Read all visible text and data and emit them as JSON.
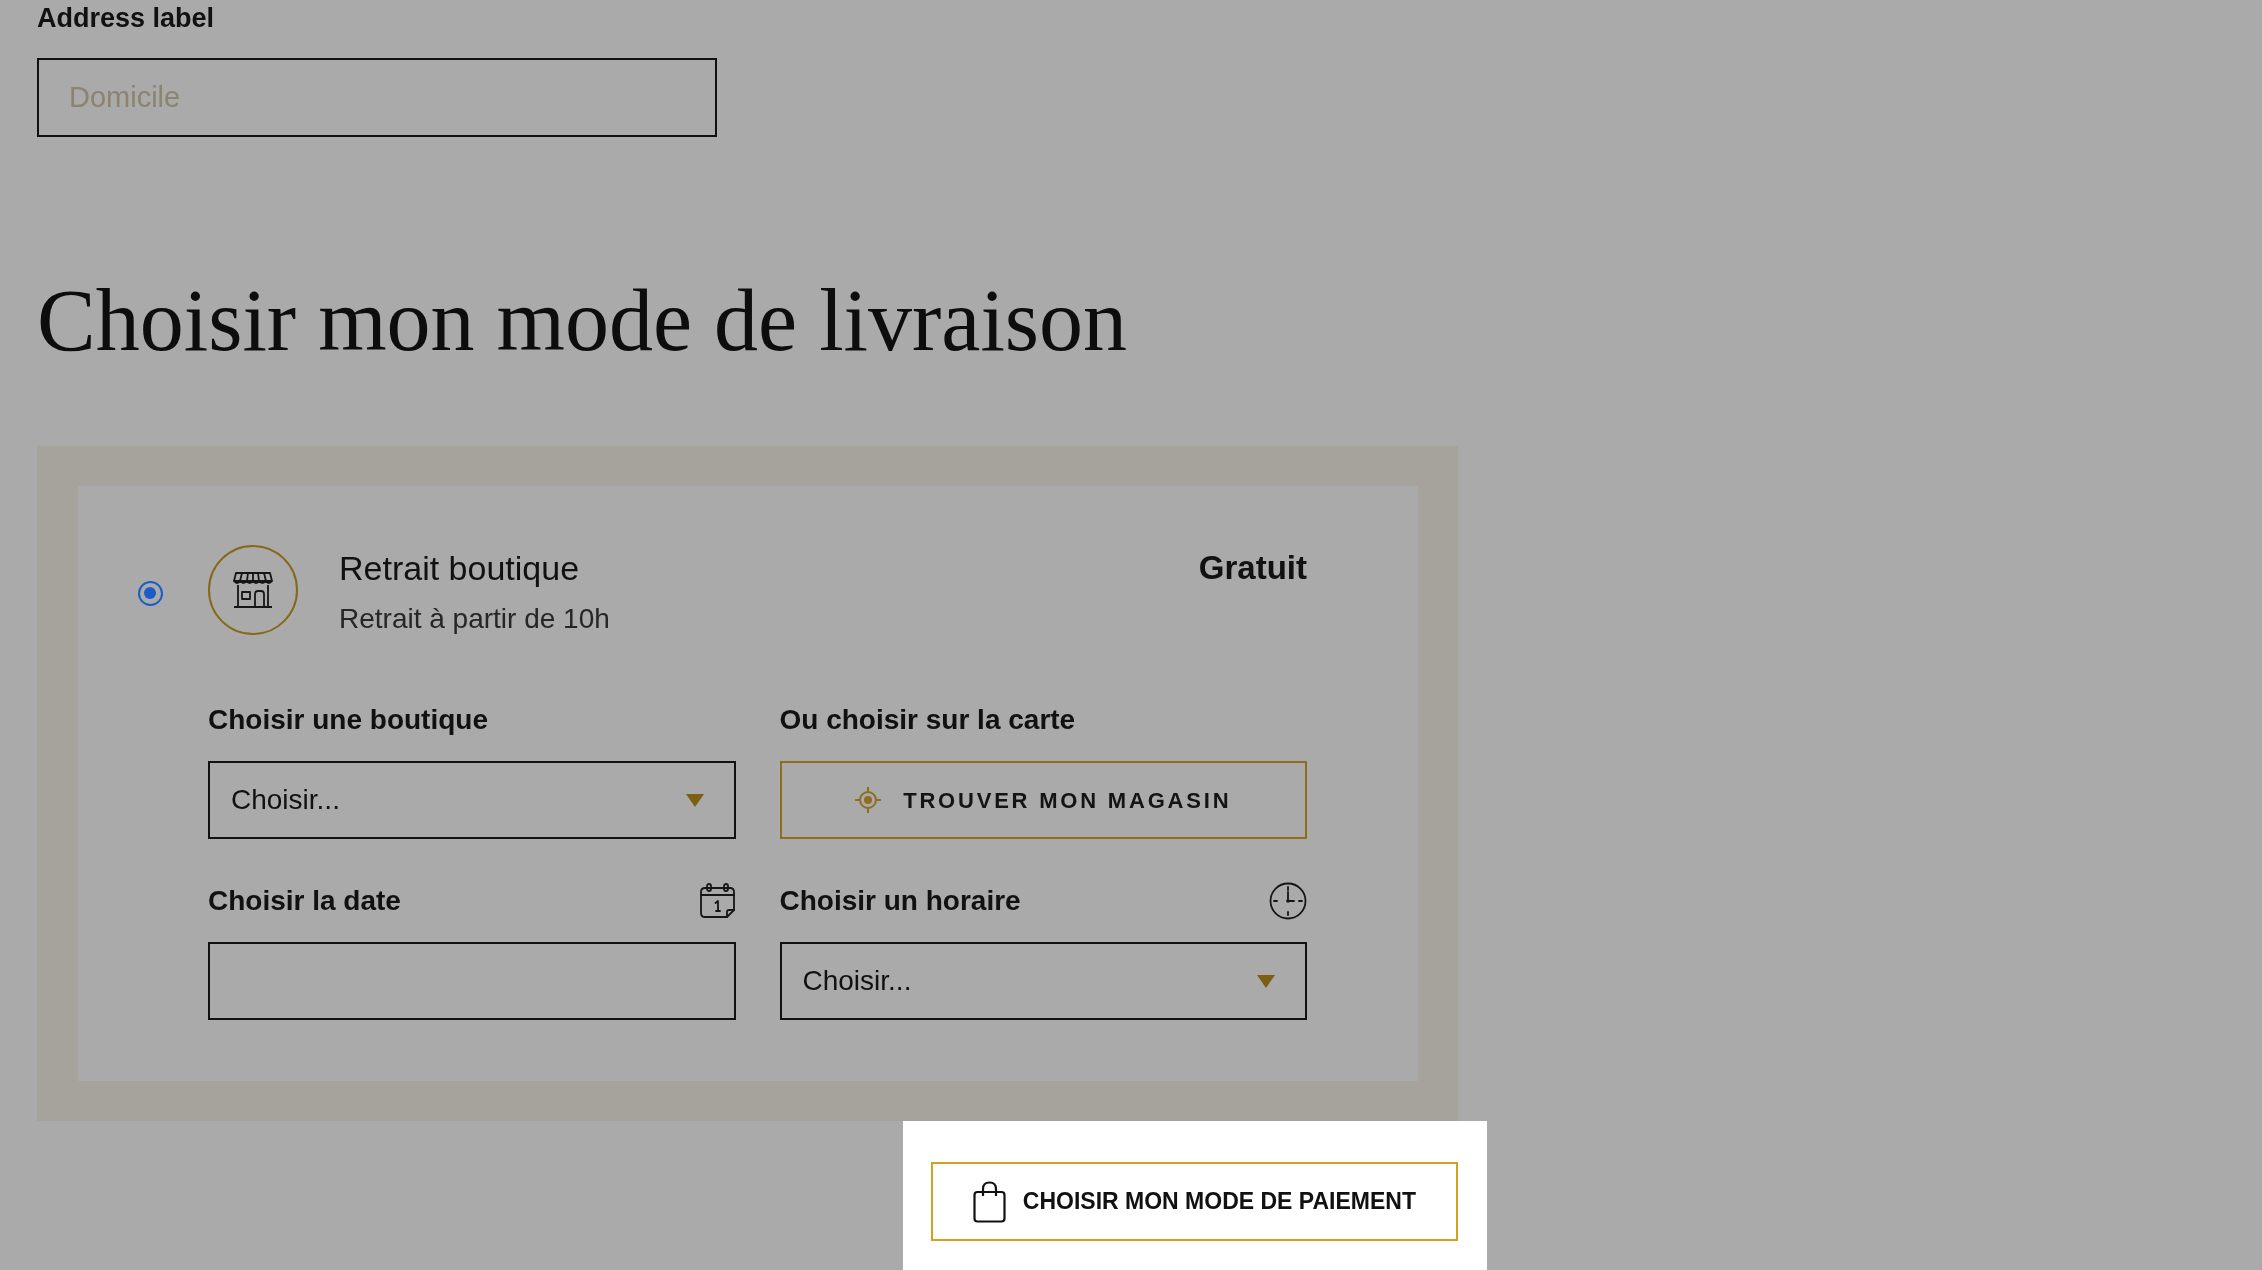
{
  "address_field": {
    "label": "Address label",
    "placeholder": "Domicile"
  },
  "heading": "Choisir mon mode de livraison",
  "delivery_options": [
    {
      "selected": true,
      "title": "Retrait boutique",
      "subtitle": "Retrait à partir de 10h",
      "price": "Gratuit",
      "store_select": {
        "label": "Choisir une boutique",
        "value": "Choisir..."
      },
      "map_search": {
        "label": "Ou choisir sur la carte",
        "button": "TROUVER MON MAGASIN"
      },
      "date_field": {
        "label": "Choisir la date"
      },
      "time_select": {
        "label": "Choisir un horaire",
        "value": "Choisir..."
      }
    }
  ],
  "payment_button": "CHOISIR MON MODE DE PAIEMENT"
}
